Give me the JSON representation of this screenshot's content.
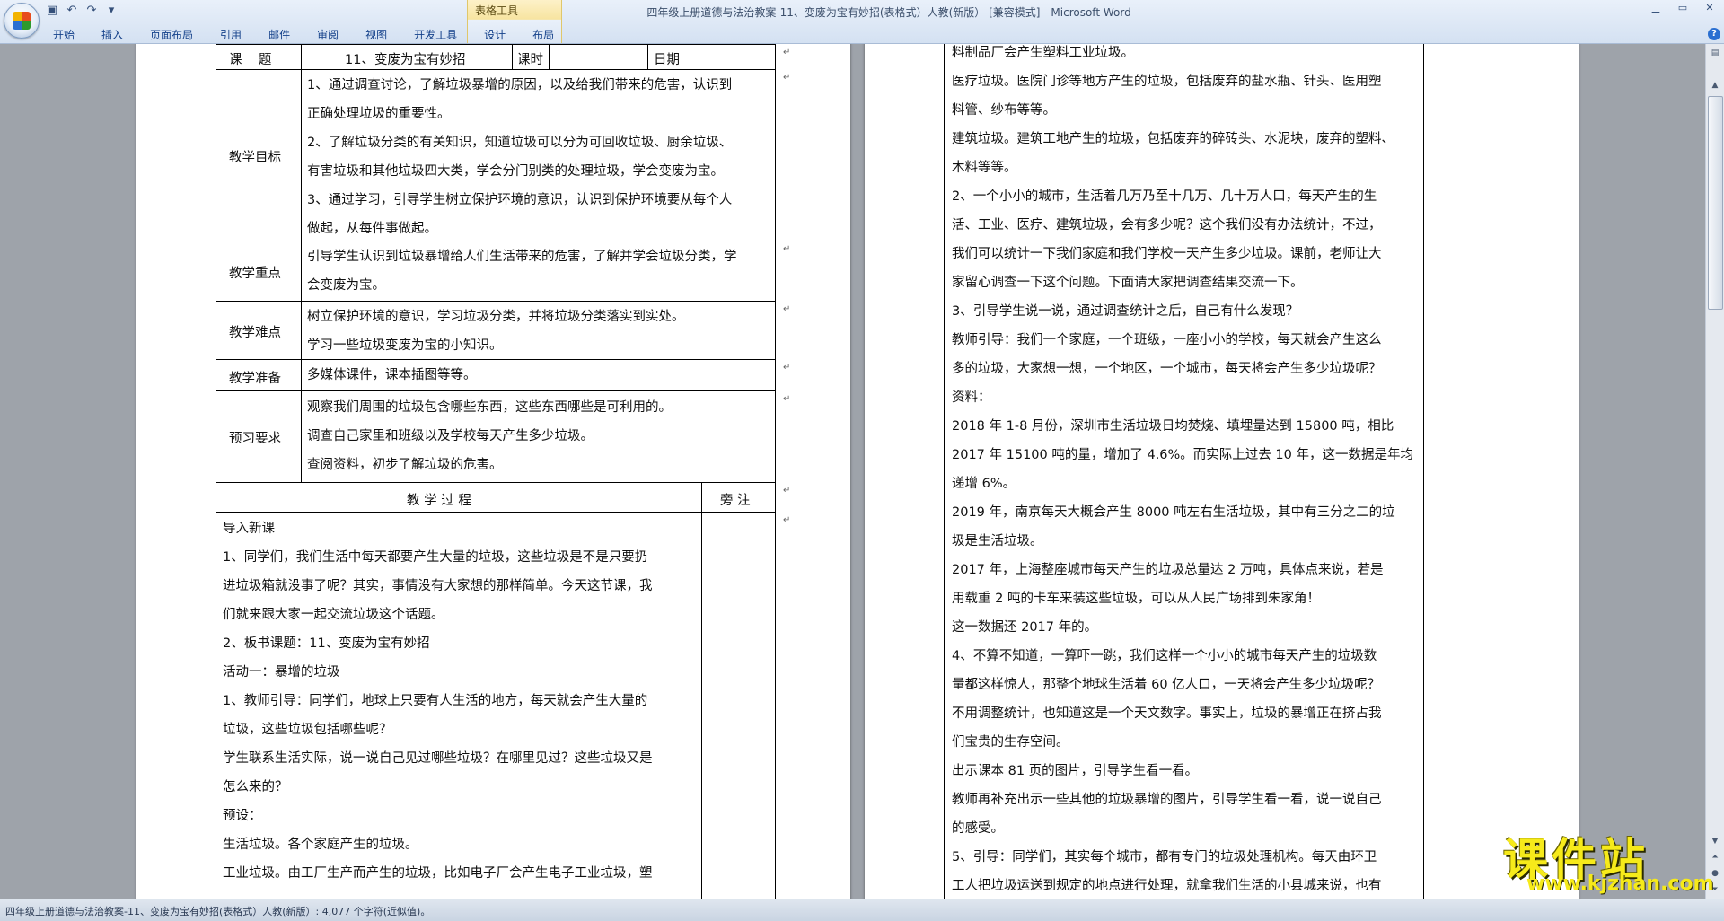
{
  "window": {
    "title": "四年级上册道德与法治教案-11、变废为宝有妙招(表格式）人教(新版） [兼容模式] - Microsoft Word",
    "context_tab_group": "表格工具"
  },
  "ribbon": {
    "tabs": [
      "开始",
      "插入",
      "页面布局",
      "引用",
      "邮件",
      "审阅",
      "视图",
      "开发工具",
      "设计",
      "布局"
    ]
  },
  "table": {
    "row1": {
      "label": "课    题",
      "topic": "11、变废为宝有妙招",
      "period_label": "课时",
      "date_label": "日期"
    },
    "goals": {
      "label": "教学目标",
      "lines": [
        "1、通过调查讨论，了解垃圾暴增的原因，以及给我们带来的危害，认识到",
        "正确处理垃圾的重要性。",
        "2、了解垃圾分类的有关知识，知道垃圾可以分为可回收垃圾、厨余垃圾、",
        "有害垃圾和其他垃圾四大类，学会分门别类的处理垃圾，学会变废为宝。",
        "3、通过学习，引导学生树立保护环境的意识，认识到保护环境要从每个人",
        "做起，从每件事做起。"
      ]
    },
    "key_points": {
      "label": "教学重点",
      "lines": [
        "引导学生认识到垃圾暴增给人们生活带来的危害，了解并学会垃圾分类，学",
        "会变废为宝。"
      ]
    },
    "difficulties": {
      "label": "教学难点",
      "lines": [
        "树立保护环境的意识，学习垃圾分类，并将垃圾分类落实到实处。",
        "学习一些垃圾变废为宝的小知识。"
      ]
    },
    "preparation": {
      "label": "教学准备",
      "lines": [
        "多媒体课件，课本插图等等。"
      ]
    },
    "preview": {
      "label": "预习要求",
      "lines": [
        "观察我们周围的垃圾包含哪些东西，这些东西哪些是可利用的。",
        "调查自己家里和班级以及学校每天产生多少垃圾。",
        "查阅资料，初步了解垃圾的危害。"
      ]
    },
    "process_header": "教 学 过 程",
    "notes_header": "旁 注"
  },
  "process_left": [
    "导入新课",
    "1、同学们，我们生活中每天都要产生大量的垃圾，这些垃圾是不是只要扔",
    "进垃圾箱就没事了呢？其实，事情没有大家想的那样简单。今天这节课，我",
    "们就来跟大家一起交流垃圾这个话题。",
    "2、板书课题：11、变废为宝有妙招",
    "活动一：暴增的垃圾",
    "1、教师引导：同学们，地球上只要有人生活的地方，每天就会产生大量的",
    "垃圾，这些垃圾包括哪些呢？",
    "学生联系生活实际，说一说自己见过哪些垃圾？在哪里见过？这些垃圾又是",
    "怎么来的？",
    "预设：",
    "生活垃圾。各个家庭产生的垃圾。",
    "工业垃圾。由工厂生产而产生的垃圾，比如电子厂会产生电子工业垃圾，塑"
  ],
  "process_right": [
    "料制品厂会产生塑料工业垃圾。",
    "医疗垃圾。医院门诊等地方产生的垃圾，包括废弃的盐水瓶、针头、医用塑",
    "料管、纱布等等。",
    "建筑垃圾。建筑工地产生的垃圾，包括废弃的碎砖头、水泥块，废弃的塑料、",
    "木料等等。",
    "2、一个小小的城市，生活着几万乃至十几万、几十万人口，每天产生的生",
    "活、工业、医疗、建筑垃圾，会有多少呢？这个我们没有办法统计，不过，",
    "我们可以统计一下我们家庭和我们学校一天产生多少垃圾。课前，老师让大",
    "家留心调查一下这个问题。下面请大家把调查结果交流一下。",
    "3、引导学生说一说，通过调查统计之后，自己有什么发现？",
    "教师引导：我们一个家庭，一个班级，一座小小的学校，每天就会产生这么",
    "多的垃圾，大家想一想，一个地区，一个城市，每天将会产生多少垃圾呢？",
    "资料：",
    "2018 年 1-8 月份，深圳市生活垃圾日均焚烧、填埋量达到 15800 吨，相比",
    "2017 年 15100 吨的量，增加了 4.6%。而实际上过去 10 年，这一数据是年均",
    "递增 6%。",
    "2019 年，南京每天大概会产生 8000 吨左右生活垃圾，其中有三分之二的垃",
    "圾是生活垃圾。",
    "2017 年，上海整座城市每天产生的垃圾总量达 2 万吨，具体点来说，若是",
    "用载重 2 吨的卡车来装这些垃圾，可以从人民广场排到朱家角！",
    "这一数据还 2017 年的。",
    "4、不算不知道，一算吓一跳，我们这样一个小小的城市每天产生的垃圾数",
    "量都这样惊人，那整个地球生活着 60 亿人口，一天将会产生多少垃圾呢？",
    "不用调整统计，也知道这是一个天文数字。事实上，垃圾的暴增正在挤占我",
    "们宝贵的生存空间。",
    "出示课本 81 页的图片，引导学生看一看。",
    "教师再补充出示一些其他的垃圾暴增的图片，引导学生看一看，说一说自己",
    "的感受。",
    "5、引导：同学们，其实每个城市，都有专门的垃圾处理机构。每天由环卫",
    "工人把垃圾运送到规定的地点进行处理，就拿我们生活的小县城来说，也有"
  ],
  "status": {
    "text": "四年级上册道德与法治教案-11、变废为宝有妙招(表格式）人教(新版）: 4,077 个字符(近似值)。"
  },
  "watermark": {
    "title": "课件站",
    "url": "www.kjzhan.com"
  },
  "icons": [
    "office-button-icon",
    "save-icon",
    "undo-icon",
    "redo-icon",
    "customize-qat-icon",
    "minimize-icon",
    "maximize-icon",
    "close-icon",
    "help-icon",
    "ruler-toggle-icon",
    "scroll-up-icon",
    "scroll-down-icon",
    "prev-page-icon",
    "select-browse-object-icon",
    "next-page-icon"
  ]
}
